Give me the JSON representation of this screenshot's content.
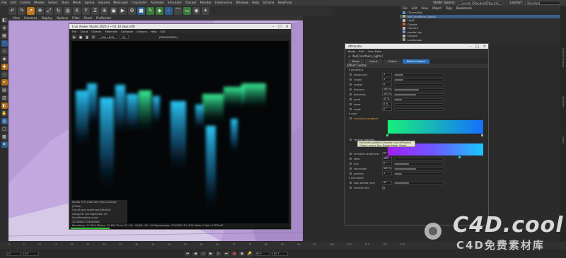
{
  "menubar": {
    "items": [
      "File",
      "Edit",
      "Create",
      "Modes",
      "Select",
      "Tools",
      "Mesh",
      "Spline",
      "Volume",
      "MoGraph",
      "Character",
      "Animate",
      "Simulate",
      "Tracker",
      "Render",
      "Extensions",
      "Window",
      "Help",
      "Octane",
      "RealFlow"
    ]
  },
  "nodespace": {
    "label": "Node Space:",
    "value": "Current (Standard/Physical)"
  },
  "layout": {
    "label": "Layout:",
    "value": "Standard"
  },
  "viewport_menu": {
    "items": [
      "View",
      "Cameras",
      "Display",
      "Options",
      "Filter",
      "Panel",
      "ProRender"
    ]
  },
  "picture_viewer": {
    "title": "Live Viewer Studio 2020.1 • R1.18 days left)",
    "menu": [
      "File",
      "Cloud",
      "Objects",
      "Materials",
      "Compare",
      "Options",
      "Help",
      "GUI"
    ],
    "rendering_label": "[RENDERING]",
    "hdr_select": "HDR sRGB",
    "dl_select": "DL",
    "stats": [
      "Nvidia GTX 1080 with Max-Q Design (PCIe1)",
      "Out-of-core used/max:0Kb/4Gb",
      "Grey8/16: 0/0      Rgb32/64: 0/1",
      "Used/free/total vram: 2012Mb/5.434Gb/8Gb"
    ],
    "status": "Rendering: 17.69%   Ms/sec: 12.4B4   Time: 00 : 00 : 01/00 : 00 : 04   Spp/maxspp: 179/1024   Tri: 0/7k   Mesh: 0   Hair: 0   RTX:off",
    "progress": 0.177
  },
  "attribute_manager": {
    "title": "Attributes",
    "menu": [
      "Mode",
      "Edit",
      "User Data"
    ],
    "object_name": "Null [northern_lights]",
    "tabs": [
      "Basic",
      "Coord.",
      "Object",
      "Effect Control"
    ],
    "active_tab": "Effect Control",
    "section_title": "Effect Control",
    "geometry_header": "▾ geometry",
    "geometry": [
      {
        "label": "global size",
        "value": "1",
        "fill": 0.18
      },
      {
        "label": "height",
        "value": "1",
        "fill": 0.18
      },
      {
        "label": "scatter",
        "value": "0",
        "fill": 0.0
      },
      {
        "label": "distance",
        "value": "200 %",
        "fill": 0.5
      },
      {
        "label": "distortion",
        "value": "150 %",
        "fill": 0.44
      },
      {
        "label": "bend",
        "value": "15 %",
        "fill": 0.14
      },
      {
        "label": "wave",
        "value": "0 %",
        "fill": 0.0
      },
      {
        "label": "angle",
        "value": "0 °",
        "fill": 0.0
      }
    ],
    "color_header": "▾ color",
    "horizontal_gradient_label": "horizontal gradient",
    "vertical_gradient_label": "vertical gradient",
    "tooltip": "horizontal gradient [Userport conctrlProject]  Object: aurora  Tag: Shader  Node: Object",
    "gradient_colors": {
      "h_start": "#18f07a",
      "h_end": "#1570ff",
      "v_start": "#a020f0",
      "v_mid": "#6a5cff",
      "v_end": "#18c8ff"
    },
    "color_params": [
      {
        "label": "emission brightness",
        "value": "25",
        "fill": 0.2
      },
      {
        "label": "seed",
        "value": "100",
        "fill": 0.0
      },
      {
        "label": "hue",
        "value": "0 °",
        "fill": 0.3
      },
      {
        "label": "saturation",
        "value": "100 %",
        "fill": 0.44
      },
      {
        "label": "gamma",
        "value": "1",
        "fill": 0.14
      }
    ],
    "animation_header": "▾ animation",
    "animation": [
      {
        "label": "loop period (sec)",
        "value": "10",
        "fill": 0.3
      },
      {
        "label": "reverse trail",
        "value": "",
        "fill": 0
      }
    ]
  },
  "object_manager": {
    "menu": [
      "File",
      "Edit",
      "View",
      "Object",
      "Tags",
      "Bookmarks"
    ],
    "rows": [
      {
        "name": "OSceneSky",
        "color": "#58a0e0",
        "selected": false
      },
      {
        "name": "Null [northern_lights]",
        "color": "#e0a030",
        "selected": true
      },
      {
        "name": "Light",
        "color": "#c0c0c0",
        "selected": false
      },
      {
        "name": "Octane",
        "color": "#e06030",
        "selected": false
      },
      {
        "name": "Camera",
        "color": "#c0c0c0",
        "selected": false
      },
      {
        "name": "render sky",
        "color": "#70a0e0",
        "selected": false
      },
      {
        "name": "Ground",
        "color": "#c0c0c0",
        "selected": false
      },
      {
        "name": "Landscape",
        "color": "#a0a0a0",
        "selected": false
      }
    ]
  },
  "right_strip": [
    "Content Browser",
    "Attributes",
    "Layers"
  ],
  "timeline": {
    "ticks": [
      "0",
      "5",
      "10",
      "15",
      "20",
      "25",
      "30",
      "35",
      "40",
      "45",
      "50",
      "55",
      "60",
      "65",
      "70",
      "75",
      "80",
      "85",
      "90",
      "95",
      "100",
      "105",
      "110",
      "115",
      "120"
    ],
    "start_frame": "0 F",
    "current_frame": "0 F",
    "end_frame": "90 F",
    "fps": "90 F"
  },
  "watermark": {
    "main": "C4D.cool",
    "sub": "C4D免费素材库"
  },
  "colors": {
    "viewport_bg": "#b79ad6",
    "accent": "#2e6fb7",
    "progress": "#35c43a"
  }
}
